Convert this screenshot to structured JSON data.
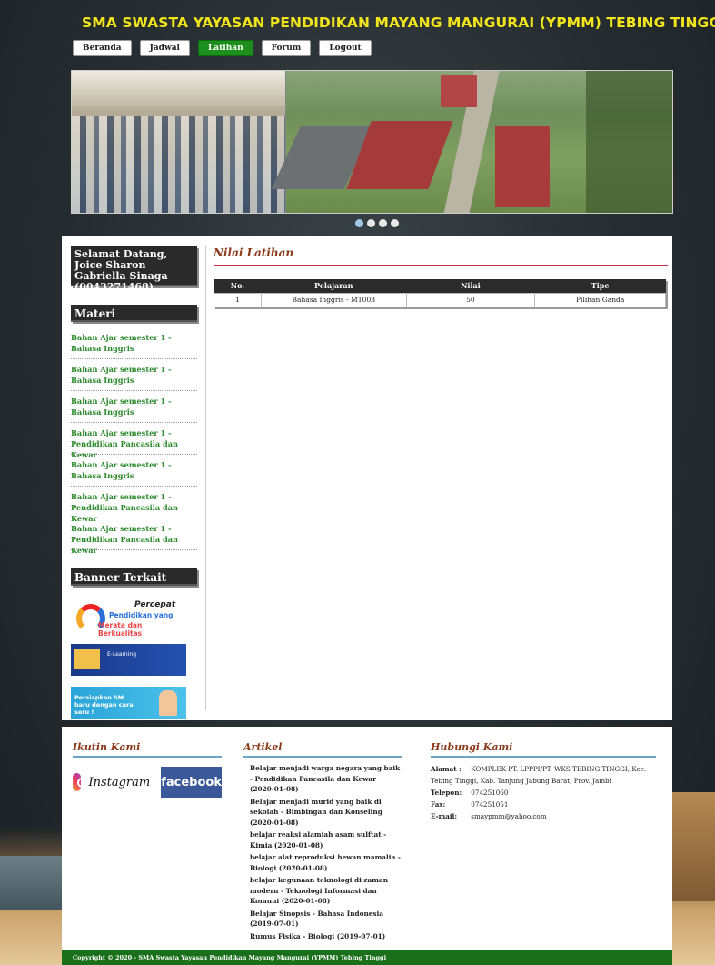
{
  "header": {
    "title": "SMA SWASTA YAYASAN PENDIDIKAN MAYANG MANGURAI (YPMM) TEBING TINGGI",
    "title_color": "#f2e51c"
  },
  "nav": {
    "items": [
      "Beranda",
      "Jadwal",
      "Latihan",
      "Forum",
      "Logout"
    ],
    "active": "Latihan",
    "active_color": "#1c8f1c"
  },
  "slider": {
    "slide_count": 4,
    "active_index": 0
  },
  "sidebar": {
    "welcome": "Selamat Datang, Joice Sharon Gabriella Sinaga (0043271468)",
    "materi_title": "Materi",
    "materi_items": [
      "Bahan Ajar semester 1 - Bahasa Inggris",
      "Bahan Ajar semester 1 - Bahasa Inggris",
      "Bahan Ajar semester 1 - Bahasa Inggris",
      "Bahan Ajar semester 1 - Pendidikan Pancasila dan Kewar",
      "Bahan Ajar semester 1 - Bahasa Inggris",
      "Bahan Ajar semester 1 - Pendidikan Pancasila dan Kewar",
      "Bahan Ajar semester 1 - Pendidikan Pancasila dan Kewar"
    ],
    "banner_title": "Banner Terkait",
    "banner1": {
      "line1": "Percepat",
      "line2": "Pendidikan yang",
      "line3": "Merata dan Berkualitas"
    },
    "banner2": {
      "text": "E-Learning"
    },
    "banner3": {
      "text": "Persiapkan SM baru dengan cara seru !"
    }
  },
  "main": {
    "title": "Nilai Latihan",
    "table": {
      "headers": [
        "No.",
        "Pelajaran",
        "Nilai",
        "Tipe"
      ],
      "rows": [
        [
          "1",
          "Bahasa Inggris - MT003",
          "50",
          "Pilihan Ganda"
        ]
      ]
    }
  },
  "footer": {
    "follow_title": "Ikutin Kami",
    "instagram_label": "Instagram",
    "facebook_label": "facebook",
    "articles_title": "Artikel",
    "articles": [
      "Belajar menjadi warga negara yang baik - Pendidikan Pancasila dan Kewar (2020-01-08)",
      "Belajar menjadi murid yang baik di sekolah - Bimbingan dan Konseling (2020-01-08)",
      "belajar reaksi alamiah asam sulftat - Kimia (2020-01-08)",
      "belajar alat reproduksi hewan mamalia - Biologi (2020-01-08)",
      "belajar kegunaan teknologi di zaman modern - Teknologi Informasi dan Komuni (2020-01-08)",
      "Belajar Sinopsis - Bahasa Indonesia (2019-07-01)",
      "Rumus Fisika - Biologi (2019-07-01)"
    ],
    "contact_title": "Hubungi Kami",
    "contact": {
      "alamat_label": "Alamat :",
      "alamat": "KOMPLEK PT. LPPPI/PT. WKS TEBING TINGGI, Kec. Tebing Tinggi, Kab. Tanjung Jabung Barat, Prov. Jambi",
      "telepon_label": "Telepon:",
      "telepon": "074251060",
      "fax_label": "Fax:",
      "fax": "074251051",
      "email_label": "E-mail:",
      "email": "smaypmm@yahoo.com"
    },
    "copyright": "Copyright © 2020 - SMA Swasta Yayasan Pendidikan Mayang Mangurai (YPMM) Tebing Tinggi"
  }
}
